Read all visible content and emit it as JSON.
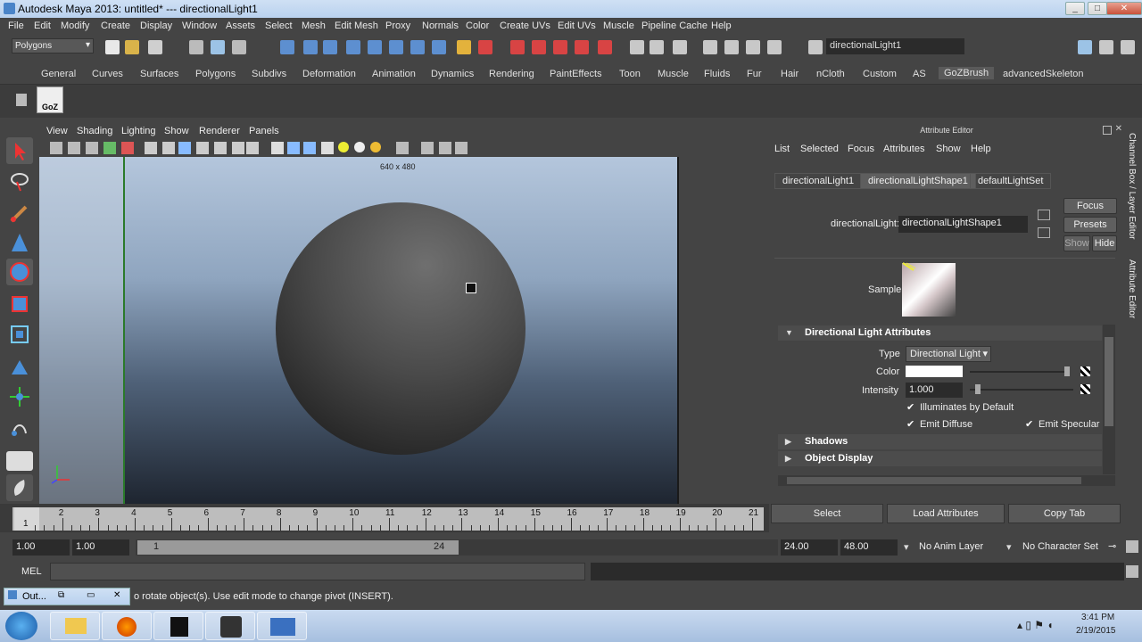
{
  "window": {
    "title": "Autodesk Maya 2013: untitled*   ---   directionalLight1",
    "min": "▭",
    "max": "▭",
    "close": "✕"
  },
  "menubar": [
    "File",
    "Edit",
    "Modify",
    "Create",
    "Display",
    "Window",
    "Assets",
    "Select",
    "Mesh",
    "Edit Mesh",
    "Proxy",
    "Normals",
    "Color",
    "Create UVs",
    "Edit UVs",
    "Muscle",
    "Pipeline Cache",
    "Help"
  ],
  "statusline": {
    "menuset": "Polygons",
    "name_field": "directionalLight1"
  },
  "shelf": {
    "tabs": [
      "General",
      "Curves",
      "Surfaces",
      "Polygons",
      "Subdivs",
      "Deformation",
      "Animation",
      "Dynamics",
      "Rendering",
      "PaintEffects",
      "Toon",
      "Muscle",
      "Fluids",
      "Fur",
      "Hair",
      "nCloth",
      "Custom",
      "AS",
      "GoZBrush",
      "advancedSkeleton"
    ],
    "active_tab": "GoZBrush",
    "goz_label": "GoZ"
  },
  "viewport": {
    "menu": [
      "View",
      "Shading",
      "Lighting",
      "Show",
      "Renderer",
      "Panels"
    ],
    "resolution": "640 x 480"
  },
  "attribute_editor": {
    "title": "Attribute Editor",
    "menu": [
      "List",
      "Selected",
      "Focus",
      "Attributes",
      "Show",
      "Help"
    ],
    "tabs": [
      "directionalLight1",
      "directionalLightShape1",
      "defaultLightSet"
    ],
    "active_tab": "directionalLightShape1",
    "node_label": "directionalLight:",
    "node_value": "directionalLightShape1",
    "focus_btn": "Focus",
    "presets_btn": "Presets",
    "show_btn": "Show",
    "hide_btn": "Hide",
    "sample_label": "Sample",
    "section_light": "Directional Light Attributes",
    "type_label": "Type",
    "type_value": "Directional Light",
    "color_label": "Color",
    "intensity_label": "Intensity",
    "intensity_value": "1.000",
    "illuminates": "Illuminates by Default",
    "emit_diffuse": "Emit Diffuse",
    "emit_specular": "Emit Specular",
    "section_shadows": "Shadows",
    "section_object_display": "Object Display",
    "select_btn": "Select",
    "load_btn": "Load Attributes",
    "copy_btn": "Copy Tab"
  },
  "side_tabs": {
    "channel_box": "Channel Box / Layer Editor",
    "attribute_editor": "Attribute Editor"
  },
  "timeline": {
    "ticks": [
      "1",
      "2",
      "3",
      "4",
      "5",
      "6",
      "7",
      "8",
      "9",
      "10",
      "11",
      "12",
      "13",
      "14",
      "15",
      "16",
      "17",
      "18",
      "19",
      "20",
      "21"
    ],
    "current": "1"
  },
  "range": {
    "start": "1.00",
    "playback_start": "1.00",
    "range_start_label": "1",
    "range_end_label": "24",
    "playback_end": "24.00",
    "end": "48.00",
    "anim_layer": "No Anim Layer",
    "character_set": "No Character Set"
  },
  "cmdline": {
    "label": "MEL"
  },
  "helpline": {
    "text": "o rotate object(s). Use edit mode to change pivot (INSERT).",
    "minimized_window": "Out..."
  },
  "taskbar": {
    "time": "3:41 PM",
    "date": "2/19/2015"
  }
}
